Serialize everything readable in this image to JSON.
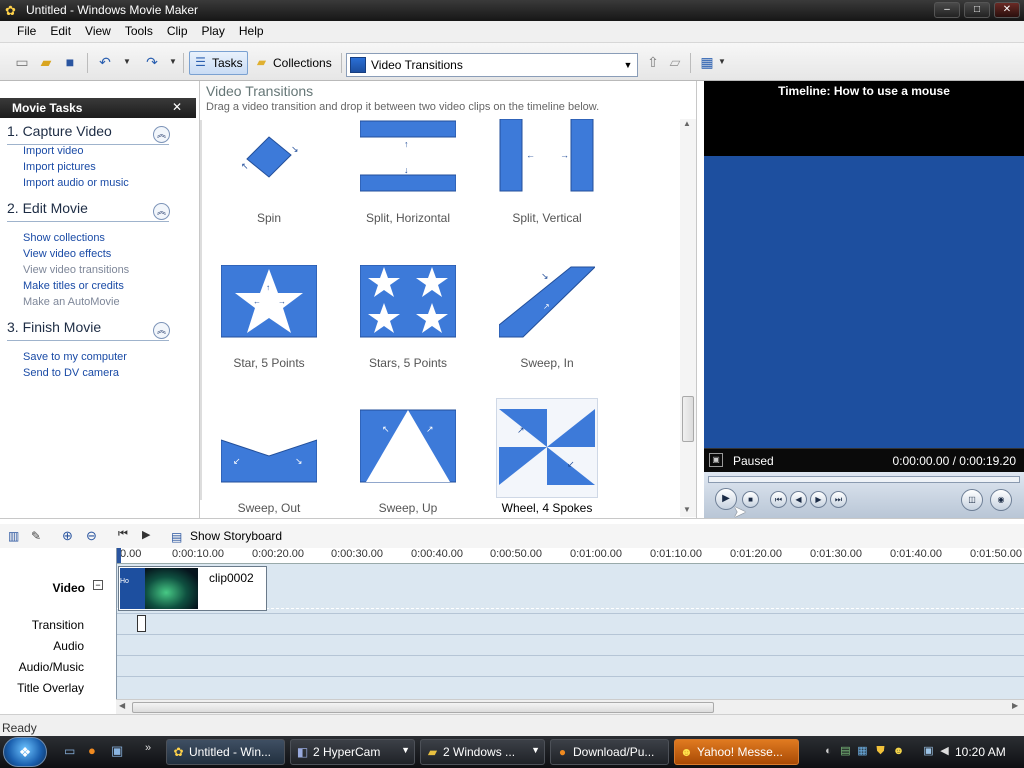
{
  "window": {
    "title": "Untitled - Windows Movie Maker",
    "minimize": "–",
    "maximize": "□",
    "close": "✕"
  },
  "menu": [
    "File",
    "Edit",
    "View",
    "Tools",
    "Clip",
    "Play",
    "Help"
  ],
  "toolbar": {
    "tasks_label": "Tasks",
    "collections_label": "Collections",
    "collection_select": "Video Transitions"
  },
  "movie_tasks": {
    "header": "Movie Tasks",
    "close": "✕",
    "sections": [
      {
        "title": "1. Capture Video",
        "links": [
          {
            "label": "Import video",
            "enabled": true
          },
          {
            "label": "Import pictures",
            "enabled": true
          },
          {
            "label": "Import audio or music",
            "enabled": true
          }
        ]
      },
      {
        "title": "2. Edit Movie",
        "links": [
          {
            "label": "Show collections",
            "enabled": true
          },
          {
            "label": "View video effects",
            "enabled": true
          },
          {
            "label": "View video transitions",
            "enabled": false
          },
          {
            "label": "Make titles or credits",
            "enabled": true
          },
          {
            "label": "Make an AutoMovie",
            "enabled": false
          }
        ]
      },
      {
        "title": "3. Finish Movie",
        "links": [
          {
            "label": "Save to my computer",
            "enabled": true
          },
          {
            "label": "Send to DV camera",
            "enabled": true
          }
        ]
      }
    ]
  },
  "transitions": {
    "title": "Video Transitions",
    "description": "Drag a video transition and drop it between two video clips on the timeline below.",
    "items": [
      "Spin",
      "Split, Horizontal",
      "Split, Vertical",
      "Star, 5 Points",
      "Stars, 5 Points",
      "Sweep, In",
      "Sweep, Out",
      "Sweep, Up",
      "Wheel, 4 Spokes"
    ],
    "selected": "Wheel, 4 Spokes"
  },
  "preview": {
    "title": "Timeline: How to use a mouse",
    "status": "Paused",
    "time": "0:00:00.00 / 0:00:19.20"
  },
  "timeline": {
    "storyboard_label": "Show Storyboard",
    "ruler": [
      "0.00",
      "0:00:10.00",
      "0:00:20.00",
      "0:00:30.00",
      "0:00:40.00",
      "0:00:50.00",
      "0:01:00.00",
      "0:01:10.00",
      "0:01:20.00",
      "0:01:30.00",
      "0:01:40.00",
      "0:01:50.00"
    ],
    "tracks": {
      "video": "Video",
      "transition": "Transition",
      "audio": "Audio",
      "audio_music": "Audio/Music",
      "title_overlay": "Title Overlay"
    },
    "clip_name": "clip0002",
    "clip_thumb_text": "Ho"
  },
  "status": "Ready",
  "taskbar": {
    "buttons": [
      {
        "label": "Untitled - Win...",
        "icon": "movie-maker-icon"
      },
      {
        "label": "2 HyperCam",
        "icon": "hypercam-icon"
      },
      {
        "label": "2 Windows ...",
        "icon": "folder-icon"
      },
      {
        "label": "Download/Pu...",
        "icon": "firefox-icon"
      },
      {
        "label": "Yahoo! Messe...",
        "icon": "yahoo-messenger-icon"
      }
    ],
    "clock": "10:20 AM"
  },
  "colors": {
    "accent": "#3d7ad9",
    "preview_screen": "#1d4f9f",
    "link": "#1a4ba6"
  }
}
